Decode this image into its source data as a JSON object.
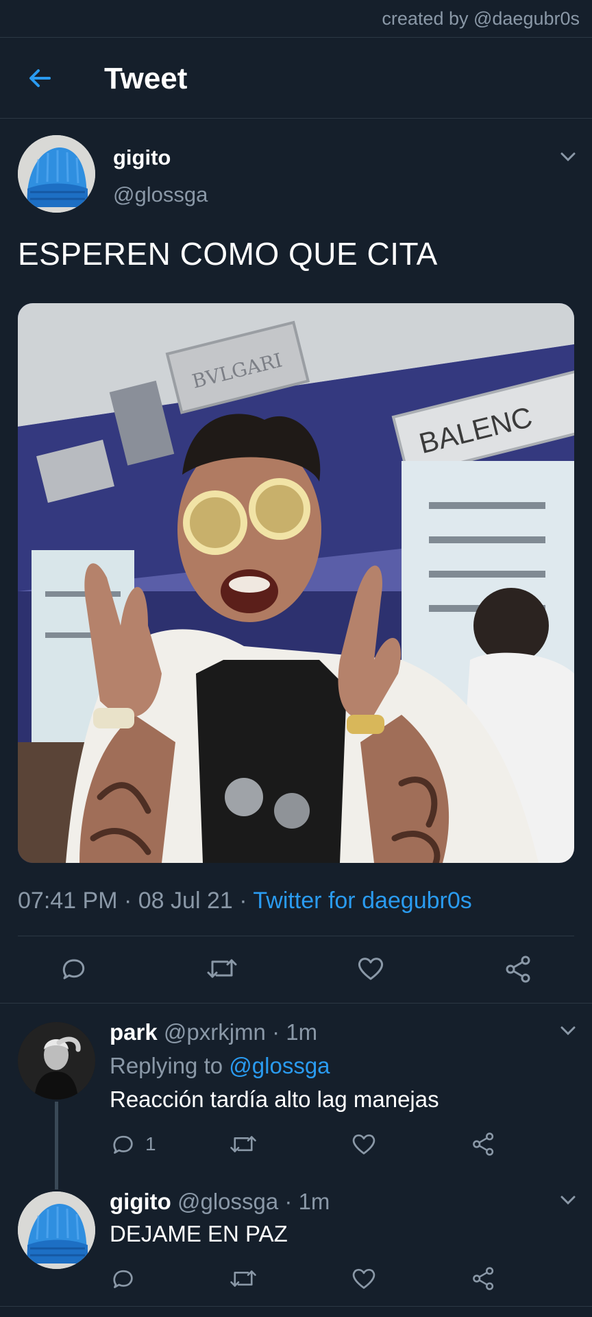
{
  "watermark": "created by @daegubr0s",
  "header": {
    "title": "Tweet",
    "back_icon": "arrow-left-icon"
  },
  "tweet": {
    "name": "gigito",
    "handle": "@glossga",
    "text": "ESPEREN COMO QUE CITA",
    "time": "07:41 PM",
    "date": "08 Jul 21",
    "source": "Twitter for daegubr0s",
    "image_signs": {
      "bvlgari": "BVLGARI",
      "balenciaga": "BALENC"
    }
  },
  "replies": [
    {
      "name": "park",
      "handle": "@pxrkjmn",
      "time": "1m",
      "replying_to_label": "Replying to",
      "replying_to": "@glossga",
      "text": "Reacción tardía alto lag manejas",
      "reply_count": "1"
    },
    {
      "name": "gigito",
      "handle": "@glossga",
      "time": "1m",
      "text": "DEJAME EN PAZ"
    }
  ],
  "colors": {
    "background": "#151f2b",
    "accent": "#2a9bf0",
    "muted": "#8a98a7"
  }
}
